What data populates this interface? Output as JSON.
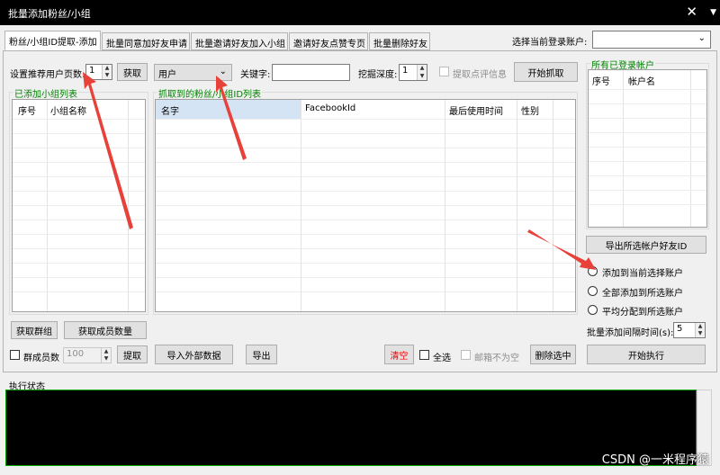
{
  "window": {
    "title": "批量添加粉丝/小组",
    "close_glyph": "✕",
    "menu_glyph": "▼"
  },
  "tabs": [
    "粉丝/小组ID提取-添加",
    "批量同意加好友申请",
    "批量邀请好友加入小组",
    "邀请好友点赞专页",
    "批量删除好友"
  ],
  "account_select": {
    "label": "选择当前登录账户:",
    "value": ""
  },
  "left": {
    "pages_label": "设置推荐用户页数:",
    "pages_value": "1",
    "fetch_button": "获取",
    "group_list_title": "已添加小组列表",
    "group_cols": [
      "序号",
      "小组名称"
    ],
    "get_groups_button": "获取群组",
    "get_members_button": "获取成员数量",
    "member_count_label": "群成员数",
    "member_count_value": "100",
    "extract_button": "提取"
  },
  "middle": {
    "type_select": "用户",
    "keyword_label": "关键字:",
    "keyword_value": "",
    "depth_label": "挖掘深度:",
    "depth_value": "1",
    "extract_comment_label": "提取点评信息",
    "start_fetch_button": "开始抓取",
    "list_title": "抓取到的粉丝/小组ID列表",
    "cols": [
      "名字",
      "FacebookId",
      "最后使用时间",
      "性别"
    ],
    "import_button": "导入外部数据",
    "export_button": "导出",
    "clear_button": "清空",
    "select_all_label": "全选",
    "email_label": "邮箱不为空",
    "delete_selected_button": "删除选中"
  },
  "right": {
    "accounts_title": "所有已登录帐户",
    "cols": [
      "序号",
      "帐户名"
    ],
    "export_friends_button": "导出所选帐户好友ID",
    "radio_options": [
      "添加到当前选择账户",
      "全部添加到所选账户",
      "平均分配到所选账户"
    ],
    "interval_label": "批量添加间隔时间(s):",
    "interval_value": "5",
    "execute_button": "开始执行"
  },
  "status": {
    "title": "执行状态"
  },
  "watermark": "CSDN @一米程序猿",
  "colors": {
    "group_label": "#008000",
    "clear_text": "#ff0000",
    "console_bg": "#000000",
    "console_border": "#00a000",
    "annotation_arrow": "#e8413a"
  }
}
